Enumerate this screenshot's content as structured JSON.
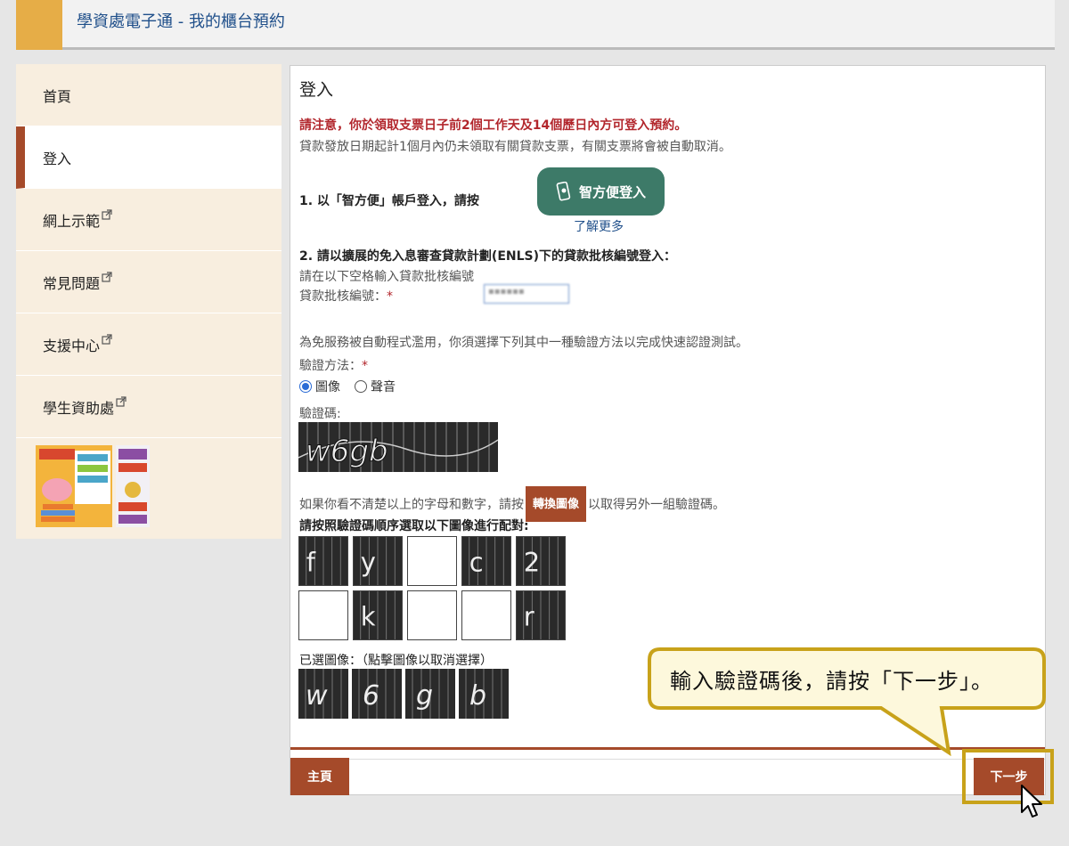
{
  "header": {
    "title": "學資處電子通 - 我的櫃台預約"
  },
  "sidebar": {
    "items": [
      {
        "label": "首頁",
        "external": false
      },
      {
        "label": "登入",
        "external": false,
        "active": true
      },
      {
        "label": "網上示範",
        "external": true
      },
      {
        "label": "常見問題",
        "external": true
      },
      {
        "label": "支援中心",
        "external": true
      },
      {
        "label": "學生資助處",
        "external": true
      }
    ]
  },
  "main": {
    "title": "登入",
    "notice_red": "請注意，你於領取支票日子前2個工作天及14個歷日內方可登入預約。",
    "notice": "貸款發放日期起計1個月內仍未領取有關貸款支票，有關支票將會被自動取消。",
    "step1": "1. 以「智方便」帳戶登入，請按",
    "ifast_button": "智方便登入",
    "learn_more": "了解更多",
    "step2": "2. 請以擴展的免入息審查貸款計劃(ENLS)下的貸款批核編號登入：",
    "hint": "請在以下空格輸入貸款批核編號",
    "loan_label": "貸款批核編號：",
    "required": "*",
    "intro": "為免服務被自動程式濫用，你須選擇下列其中一種驗證方法以完成快速認證測試。",
    "method_label": "驗證方法：",
    "method_image": "圖像",
    "method_audio": "聲音",
    "captcha_label": "驗證碼:",
    "captcha_text": "w6gb",
    "switch_prefix": "如果你看不清楚以上的字母和數字，請按",
    "switch_button": "轉換圖像",
    "switch_suffix": "以取得另外一組驗證碼。",
    "match_label": "請按照驗證碼順序選取以下圖像進行配對:",
    "tiles": [
      "f",
      "y",
      "",
      "c",
      "2",
      "",
      "k",
      "",
      "",
      "r"
    ],
    "selected_label": "已選圖像：（點擊圖像以取消選擇）",
    "selected": [
      "w",
      "6",
      "g",
      "b"
    ],
    "home_button": "主頁",
    "next_button": "下一步"
  },
  "callout": {
    "text": "輸入驗證碼後，請按「下一步」。"
  },
  "colors": {
    "accent": "#a54a2a",
    "header_accent": "#e6ad47",
    "ifast": "#3d7a68",
    "callout_border": "#c8a21a",
    "callout_fill": "#fdf8dc"
  }
}
